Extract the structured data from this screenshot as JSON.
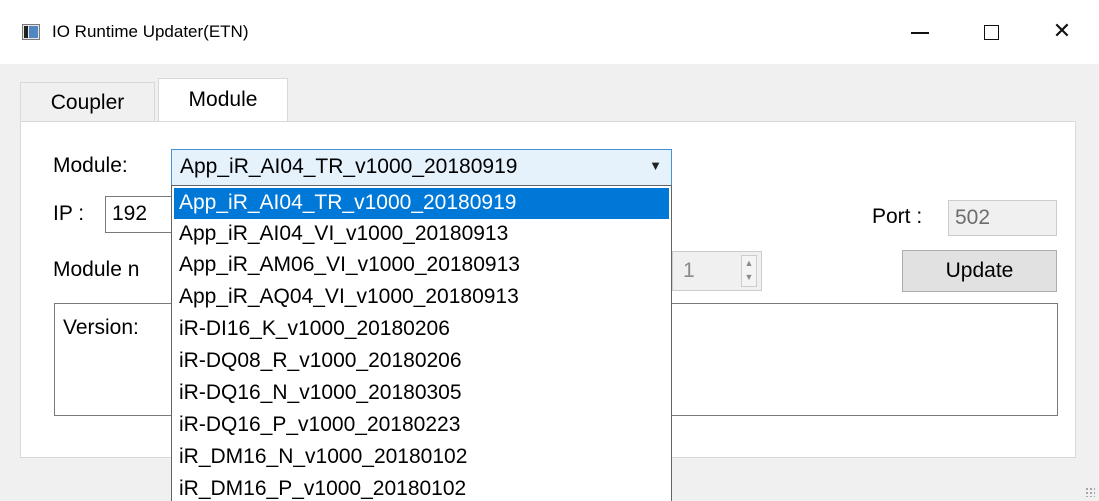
{
  "window": {
    "title": "IO Runtime Updater(ETN)",
    "controls": {
      "minimize": "─",
      "close": "✕"
    }
  },
  "tabs": [
    {
      "label": "Coupler",
      "active": false
    },
    {
      "label": "Module",
      "active": true
    }
  ],
  "form": {
    "module_label": "Module:",
    "module_selected": "App_iR_AI04_TR_v1000_20180919",
    "ip_label": "IP :",
    "ip_value": "192",
    "port_label": "Port :",
    "port_value": "502",
    "module_number_label": "Module n",
    "module_number_value": "1",
    "update_label": "Update",
    "version_label": "Version:"
  },
  "dropdown": {
    "options": [
      "App_iR_AI04_TR_v1000_20180919",
      "App_iR_AI04_VI_v1000_20180913",
      "App_iR_AM06_VI_v1000_20180913",
      "App_iR_AQ04_VI_v1000_20180913",
      "iR-DI16_K_v1000_20180206",
      "iR-DQ08_R_v1000_20180206",
      "iR-DQ16_N_v1000_20180305",
      "iR-DQ16_P_v1000_20180223",
      "iR_DM16_N_v1000_20180102",
      "iR_DM16_P_v1000_20180102"
    ],
    "selected_index": 0
  },
  "colors": {
    "selection": "#0078d7",
    "combo_focus_bg": "#e5f1fb",
    "combo_focus_border": "#4a90d6",
    "panel_bg": "#f0f0f0"
  },
  "icons": {
    "app": "app-window-icon",
    "combo_arrow": "chevron-down-icon",
    "spin_up": "chevron-up-icon",
    "spin_down": "chevron-down-icon"
  }
}
